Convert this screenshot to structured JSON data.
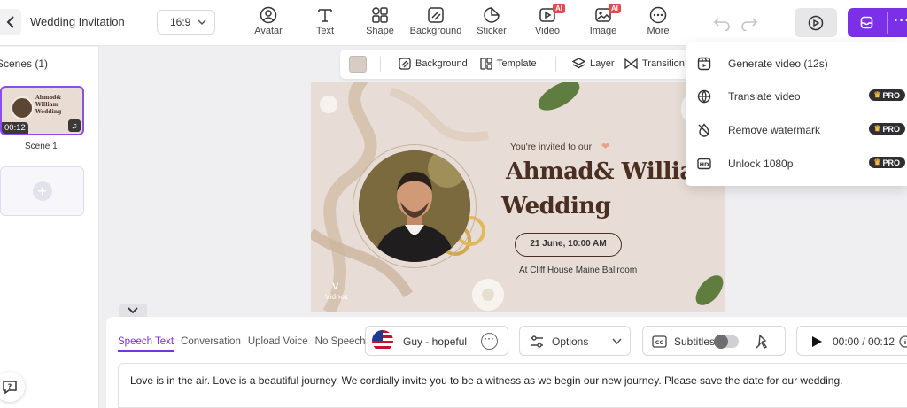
{
  "app": {
    "project_title": "Wedding Invitation",
    "aspect_ratio": "16:9",
    "accent_color": "#7b2fe6"
  },
  "toolbar": {
    "items": [
      {
        "label": "Avatar",
        "icon": "avatar-icon"
      },
      {
        "label": "Text",
        "icon": "text-icon"
      },
      {
        "label": "Shape",
        "icon": "shape-icon"
      },
      {
        "label": "Background",
        "icon": "background-icon"
      },
      {
        "label": "Sticker",
        "icon": "sticker-icon"
      },
      {
        "label": "Video",
        "icon": "video-icon",
        "badge": "AI"
      },
      {
        "label": "Image",
        "icon": "image-icon",
        "badge": "AI"
      },
      {
        "label": "More",
        "icon": "more-icon"
      }
    ]
  },
  "scenes": {
    "title": "Scenes (1)",
    "items": [
      {
        "label": "Scene 1",
        "duration": "00:12",
        "thumb_title": "Ahmad& William Wedding"
      }
    ]
  },
  "canvas_toolbar": {
    "background": "Background",
    "template": "Template",
    "layer": "Layer",
    "transition": "Transition"
  },
  "canvas": {
    "invited": "You're invited to our",
    "names": "Ahmad& Willia",
    "wedding": "Wedding",
    "date": "21 June, 10:00 AM",
    "venue": "At Cliff House Maine Ballroom",
    "watermark": "Vidnoz"
  },
  "dropdown": {
    "items": [
      {
        "label": "Generate video (12s)",
        "icon": "generate-video-icon",
        "pro": ""
      },
      {
        "label": "Translate video",
        "icon": "translate-icon",
        "pro": "PRO"
      },
      {
        "label": "Remove watermark",
        "icon": "remove-watermark-icon",
        "pro": "PRO"
      },
      {
        "label": "Unlock 1080p",
        "icon": "hd-icon",
        "pro": "PRO"
      }
    ]
  },
  "bottom": {
    "tabs": [
      "Speech Text",
      "Conversation",
      "Upload Voice",
      "No Speech"
    ],
    "active_tab": "Speech Text",
    "voice": "Guy - hopeful",
    "options": "Options",
    "subtitles": "Subtitles",
    "time": "00:00 / 00:12",
    "speech_text": "Love is in the air. Love is a beautiful journey. We cordially invite you to be a witness as we begin our new journey. Please save the date for our wedding."
  }
}
